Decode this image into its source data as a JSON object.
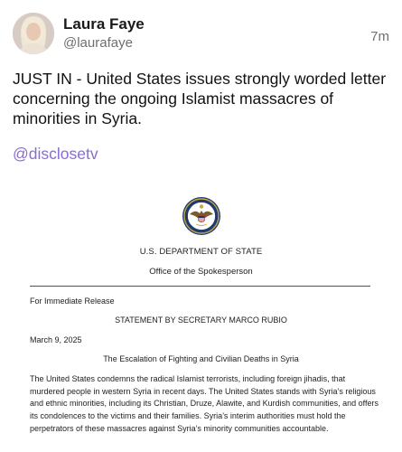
{
  "post": {
    "author_name": "Laura Faye",
    "author_handle": "@laurafaye",
    "time_ago": "7m",
    "body_text": "JUST IN - United States issues strongly worded letter concerning the ongoing Islamist massacres of minorities in Syria.",
    "mention": "@disclosetv",
    "icons": {
      "avatar": "user-avatar",
      "seal": "department-of-state-seal-icon"
    }
  },
  "document": {
    "department": "U.S. DEPARTMENT OF STATE",
    "office": "Office of the Spokesperson",
    "release_line": "For Immediate Release",
    "statement_title": "STATEMENT BY SECRETARY MARCO RUBIO",
    "date": "March 9, 2025",
    "subject": "The Escalation of Fighting and Civilian Deaths in Syria",
    "paragraph": "The United States condemns the radical Islamist terrorists, including foreign jihadis, that murdered people in western Syria in recent days.  The United States stands with Syria’s religious and ethnic minorities, including its Christian, Druze, Alawite, and Kurdish communities, and offers its condolences to the victims and their families.  Syria’s interim authorities must hold the perpetrators of these massacres against Syria’s minority communities accountable."
  },
  "colors": {
    "link": "#8a6bd8",
    "secondary_text": "#6e6e73",
    "seal_blue": "#1f3a6e",
    "seal_gold": "#c9a646"
  }
}
